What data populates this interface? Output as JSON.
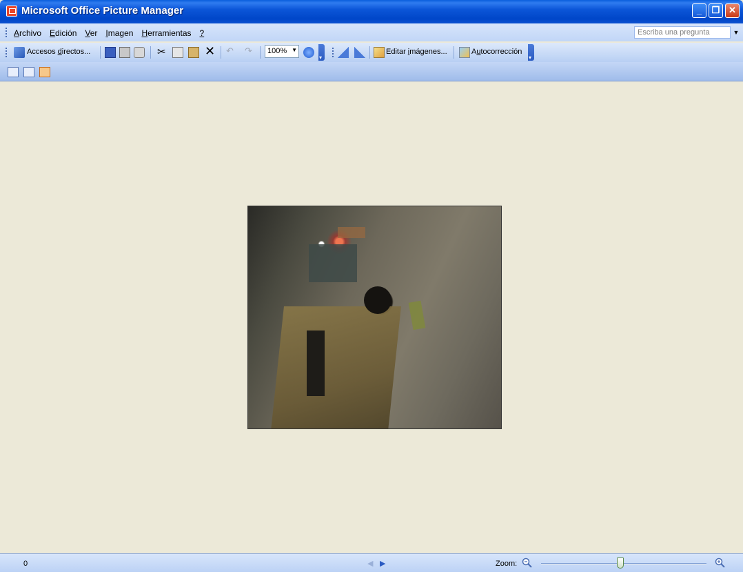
{
  "window": {
    "title": "Microsoft Office Picture Manager",
    "controls": [
      "minimize",
      "restore",
      "close"
    ]
  },
  "menu": {
    "items": [
      {
        "accel": "A",
        "rest": "rchivo"
      },
      {
        "accel": "E",
        "rest": "dición"
      },
      {
        "accel": "V",
        "rest": "er"
      },
      {
        "accel": "I",
        "rest": "magen"
      },
      {
        "accel": "H",
        "rest": "erramientas"
      },
      {
        "accel": "?",
        "rest": ""
      }
    ],
    "help_placeholder": "Escriba una pregunta"
  },
  "toolbar": {
    "shortcuts_label_a": "Accesos ",
    "shortcuts_label_accel": "d",
    "shortcuts_label_b": "irectos...",
    "zoom_value": "100%",
    "edit_label_a": "Editar ",
    "edit_label_accel": "i",
    "edit_label_b": "mágenes...",
    "autocorrect_label_a": "A",
    "autocorrect_label_accel": "u",
    "autocorrect_label_b": "tocorrección",
    "icons": [
      "shortcuts-icon",
      "save-icon",
      "print-icon",
      "send-icon",
      "cut-icon",
      "copy-icon",
      "paste-icon",
      "delete-icon",
      "undo-icon",
      "redo-icon",
      "help-icon",
      "rotate-left-icon",
      "rotate-right-icon",
      "edit-pictures-icon",
      "autocorrect-icon"
    ]
  },
  "viewbar": {
    "views": [
      "thumbnail-view",
      "filmstrip-view",
      "single-picture-view"
    ],
    "active_view": "single-picture-view"
  },
  "status": {
    "count": "0",
    "zoom_label": "Zoom:",
    "zoom_level": 0.48
  },
  "colors": {
    "titlebar": "#0046c8",
    "background": "#ece9d8",
    "close_button": "#c83a17",
    "active_view": "#f6c88a"
  }
}
